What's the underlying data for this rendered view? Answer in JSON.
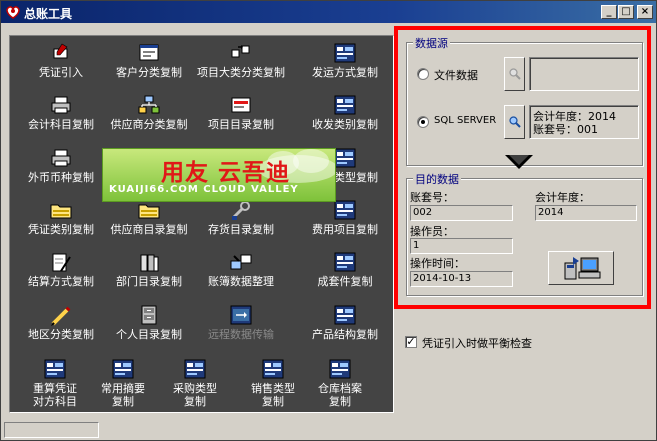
{
  "window": {
    "title": "总账工具"
  },
  "tools": [
    {
      "label": "凭证引入",
      "icon": "pen-document-icon"
    },
    {
      "label": "客户分类复制",
      "icon": "window-icon"
    },
    {
      "label": "项目大类分类复制",
      "icon": "copy-arrows-icon"
    },
    {
      "label": "发运方式复制",
      "icon": "database-table-icon"
    },
    {
      "label": "会计科目复制",
      "icon": "printer-icon"
    },
    {
      "label": "供应商分类复制",
      "icon": "network-icon"
    },
    {
      "label": "项目目录复制",
      "icon": "list-card-icon"
    },
    {
      "label": "收发类别复制",
      "icon": "database-table-icon"
    },
    {
      "label": "外币币种复制",
      "icon": "printer-icon"
    },
    {
      "label": "消耗类型复制",
      "icon": "database-table-icon"
    },
    {
      "label": "凭证类别复制",
      "icon": "folder-icon"
    },
    {
      "label": "供应商目录复制",
      "icon": "folder-icon"
    },
    {
      "label": "存货目录复制",
      "icon": "wrench-icon"
    },
    {
      "label": "费用项目复制",
      "icon": "database-table-icon"
    },
    {
      "label": "结算方式复制",
      "icon": "document-pen-icon"
    },
    {
      "label": "部门目录复制",
      "icon": "books-icon"
    },
    {
      "label": "账簿数据整理",
      "icon": "tools-icon"
    },
    {
      "label": "成套件复制",
      "icon": "database-table-icon"
    },
    {
      "label": "地区分类复制",
      "icon": "pencil-icon"
    },
    {
      "label": "个人目录复制",
      "icon": "cabinet-icon"
    },
    {
      "label": "远程数据传输",
      "icon": "transfer-icon"
    },
    {
      "label": "产品结构复制",
      "icon": "database-table-icon"
    },
    {
      "label": "重算凭证",
      "label2": "对方科目",
      "icon": "database-table-icon"
    },
    {
      "label": "常用摘要",
      "label2": "复制",
      "icon": "database-table-icon"
    },
    {
      "label": "采购类型",
      "label2": "复制",
      "icon": "database-table-icon"
    },
    {
      "label": "销售类型",
      "label2": "复制",
      "icon": "database-table-icon"
    },
    {
      "label": "仓库档案",
      "label2": "复制",
      "icon": "database-table-icon"
    }
  ],
  "banner": {
    "main": "用友 云吾迪",
    "sub": "KUAIJI66.COM CLOUD VALLEY"
  },
  "source": {
    "title": "数据源",
    "file_label": "文件数据",
    "sql_label": "SQL SERVER",
    "year_label": "会计年度：2014",
    "account_label": "账套号：001"
  },
  "target": {
    "title": "目的数据",
    "account_label": "账套号：",
    "account_value": "002",
    "year_label": "会计年度：",
    "year_value": "2014",
    "operator_label": "操作员：",
    "operator_value": "1",
    "time_label": "操作时间：",
    "time_value": "2014-10-13"
  },
  "balance_check": {
    "label": "凭证引入时做平衡检查",
    "checked": true
  }
}
